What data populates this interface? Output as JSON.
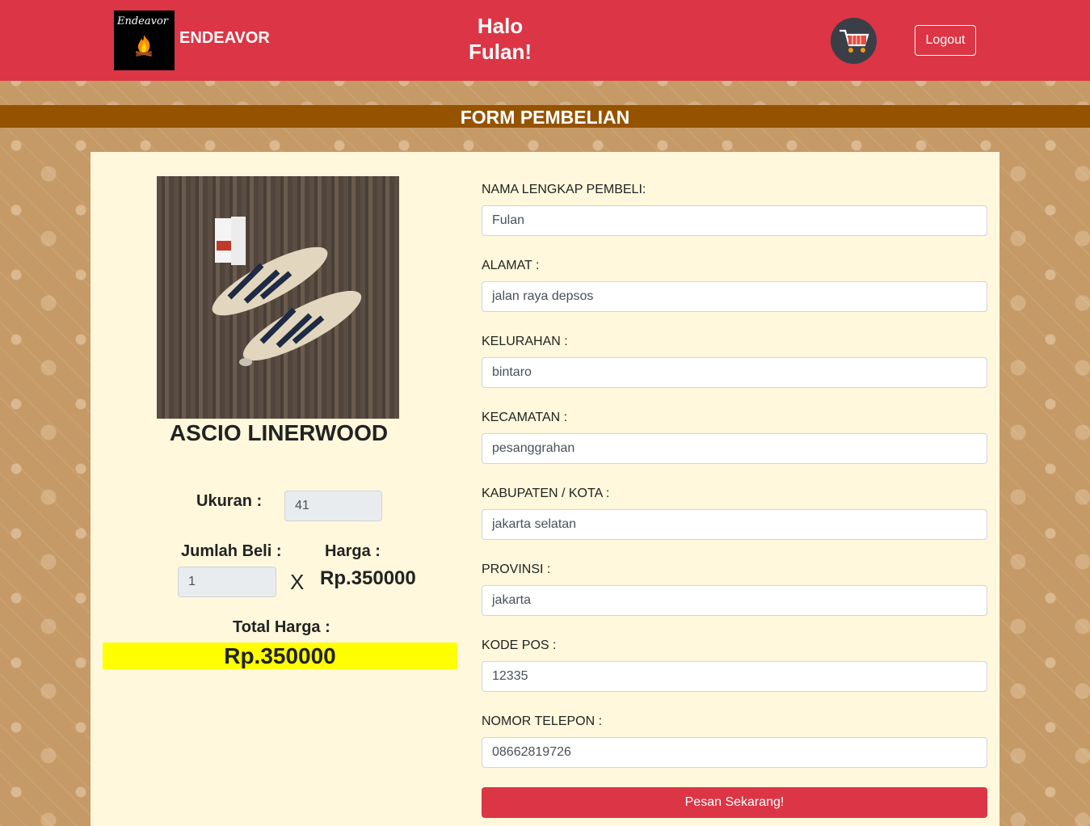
{
  "header": {
    "logo_script": "Endeavor",
    "brand": "ENDEAVOR",
    "greeting_line1": "Halo",
    "greeting_line2": "Fulan!",
    "logout_label": "Logout"
  },
  "form_title": "FORM PEMBELIAN",
  "product": {
    "name": "ASCIO LINERWOOD",
    "size_label": "Ukuran :",
    "size_value": "41",
    "qty_label": "Jumlah Beli :",
    "qty_value": "1",
    "times_symbol": "X",
    "price_label": "Harga :",
    "price_value": "Rp.350000",
    "total_label": "Total Harga :",
    "total_value": "Rp.350000"
  },
  "fields": [
    {
      "label": "NAMA LENGKAP PEMBELI:",
      "value": "Fulan"
    },
    {
      "label": "ALAMAT :",
      "value": "jalan raya depsos"
    },
    {
      "label": "KELURAHAN :",
      "value": "bintaro"
    },
    {
      "label": "KECAMATAN :",
      "value": "pesanggrahan"
    },
    {
      "label": "KABUPATEN / KOTA :",
      "value": "jakarta selatan"
    },
    {
      "label": "PROVINSI :",
      "value": "jakarta"
    },
    {
      "label": "KODE POS :",
      "value": "12335"
    },
    {
      "label": "NOMOR TELEPON :",
      "value": "08662819726"
    }
  ],
  "submit_label": "Pesan Sekarang!",
  "colors": {
    "navbar": "#dc3545",
    "title_bar": "#955300",
    "panel": "#fff8dc",
    "total_highlight": "#ffff00"
  },
  "icons": {
    "cart": "shopping-cart-icon",
    "logo": "campfire-logo"
  }
}
